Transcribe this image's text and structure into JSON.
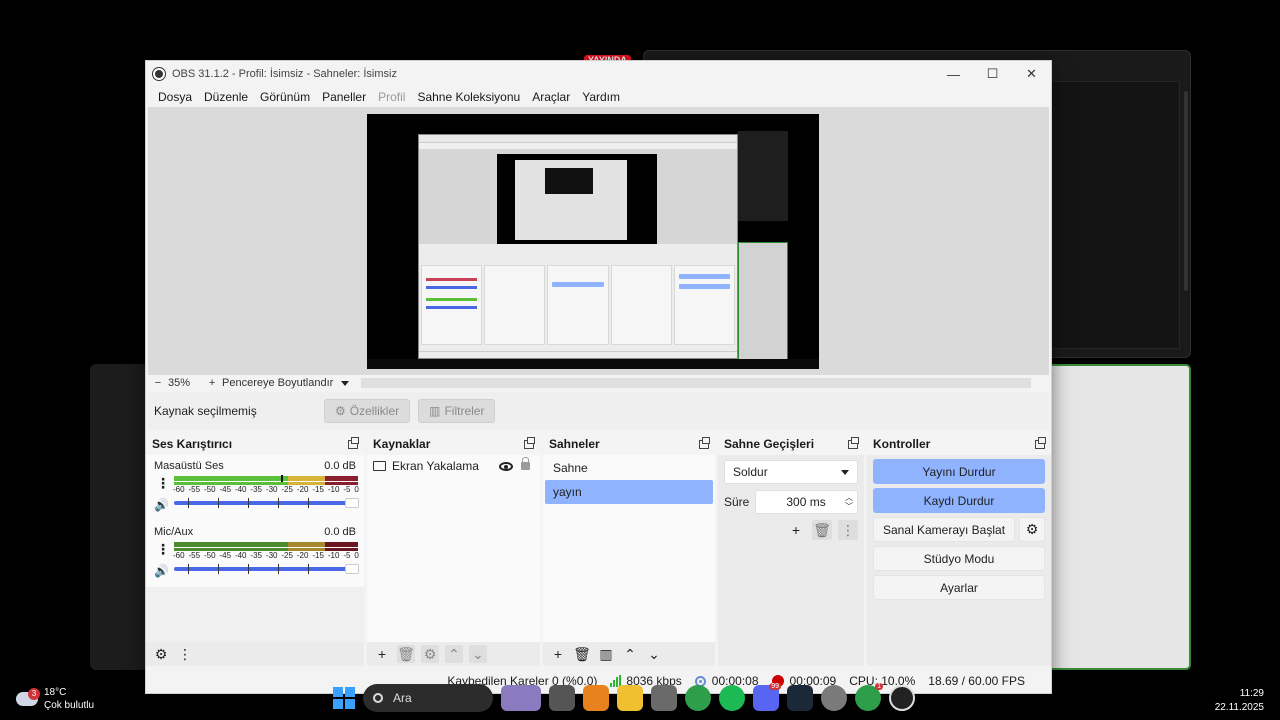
{
  "window": {
    "title": "OBS 31.1.2 - Profil: İsimsiz - Sahneler: İsimsiz",
    "minimize_glyph": "—",
    "maximize_glyph": "☐",
    "close_glyph": "✕"
  },
  "menu": [
    "Dosya",
    "Düzenle",
    "Görünüm",
    "Paneller",
    "Profil",
    "Sahne Koleksiyonu",
    "Araçlar",
    "Yardım"
  ],
  "zoom": {
    "minus": "−",
    "level": "35%",
    "plus": "+",
    "fit": "Pencereye Boyutlandır"
  },
  "source_toolbar": {
    "label": "Kaynak seçilmemiş",
    "properties": "Özellikler",
    "filters": "Filtreler"
  },
  "mixer": {
    "title": "Ses Karıştırıcı",
    "scale": [
      "-60",
      "-55",
      "-50",
      "-45",
      "-40",
      "-35",
      "-30",
      "-25",
      "-20",
      "-15",
      "-10",
      "-5",
      "0"
    ],
    "channels": [
      {
        "name": "Masaüstü Ses",
        "db": "0.0 dB"
      },
      {
        "name": "Mic/Aux",
        "db": "0.0 dB"
      }
    ]
  },
  "sources": {
    "title": "Kaynaklar",
    "items": [
      {
        "name": "Ekran Yakalama"
      }
    ]
  },
  "scenes": {
    "title": "Sahneler",
    "items": [
      "Sahne",
      "yayın"
    ],
    "selected": 1
  },
  "transitions": {
    "title": "Sahne Geçişleri",
    "selected": "Soldur",
    "duration_label": "Süre",
    "duration": "300 ms"
  },
  "controls": {
    "title": "Kontroller",
    "stop_stream": "Yayını Durdur",
    "stop_record": "Kaydı Durdur",
    "virtual_cam": "Sanal Kamerayı Başlat",
    "studio_mode": "Stüdyo Modu",
    "settings": "Ayarlar"
  },
  "status": {
    "dropped": "Kaybedilen Kareler 0 (%0.0)",
    "bitrate": "8036 kbps",
    "stream_time": "00:00:08",
    "rec_time": "00:00:09",
    "cpu": "CPU: 10.0%",
    "fps": "18.69 / 60.00 FPS"
  },
  "taskbar": {
    "temperature": "18°C",
    "weather": "Çok bulutlu",
    "weather_badge": "3",
    "search": "Ara",
    "time": "11:29",
    "date": "22.11.2025",
    "discord_badge": "99",
    "chrome_badge": "1"
  },
  "background": {
    "live_tag": "YAYINDA"
  },
  "colors": {
    "accent": "#8fb3ff",
    "record": "#cc0000",
    "meter_green": "#5cbf3a",
    "meter_yellow": "#d6b43a",
    "meter_red": "#8a1f2e"
  }
}
